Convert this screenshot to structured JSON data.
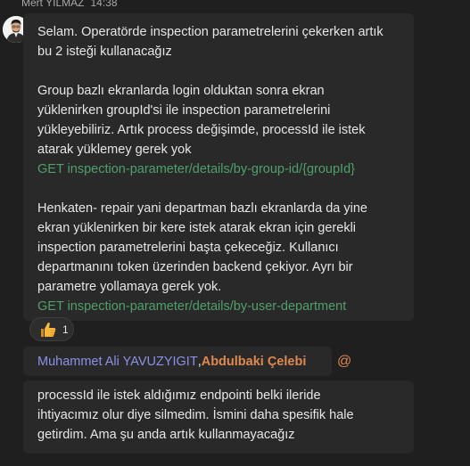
{
  "header": {
    "author": "Mert YILMAZ",
    "time": "14:38"
  },
  "message": {
    "lines": [
      "Selam. Operatörde inspection parametrelerini çekerken artık",
      "bu 2 isteği kullanacağız",
      "",
      "Group bazlı ekranlarda login olduktan sonra ekran",
      "yüklenirken groupId'si ile inspection parametrelerini",
      "yükleyebiliriz. Artık process değişimde, processId ile istek",
      "atarak yüklemey gerek yok",
      "GET inspection-parameter/details/by-group-id/{groupId}",
      "",
      "Henkaten- repair yani departman bazlı ekranlarda da yine",
      "ekran yüklenirken bir kere istek atarak ekran için gerekli",
      "inspection parametrelerini başta çekeceğiz. Kullanıcı",
      "departmanını token üzerinden backend çekiyor. Ayrı bir",
      "parametre yollamaya gerek yok.",
      "GET inspection-parameter/details/by-user-department"
    ]
  },
  "reaction": {
    "emoji_icon": "thumbs-up-icon",
    "count": "1"
  },
  "mention": {
    "name1": "Muhammet Ali YAVUZYIGIT",
    "separator": ", ",
    "name2": "Abdulbaki Çelebi",
    "at": "@"
  },
  "reply": {
    "lines": [
      "processId ile istek aldığımız endpointi belki ileride",
      "ihtiyacımız olur diye silmedim. İsmini daha spesifik hale",
      "getirdim. Ama şu anda artık kullanmayacağız"
    ]
  },
  "colors": {
    "background": "#1f1f1f",
    "bubble": "#292929",
    "link": "#4fa06a",
    "mention_primary": "#8b91e8",
    "mention_highlight": "#e0884f",
    "presence": "#6bb700"
  }
}
